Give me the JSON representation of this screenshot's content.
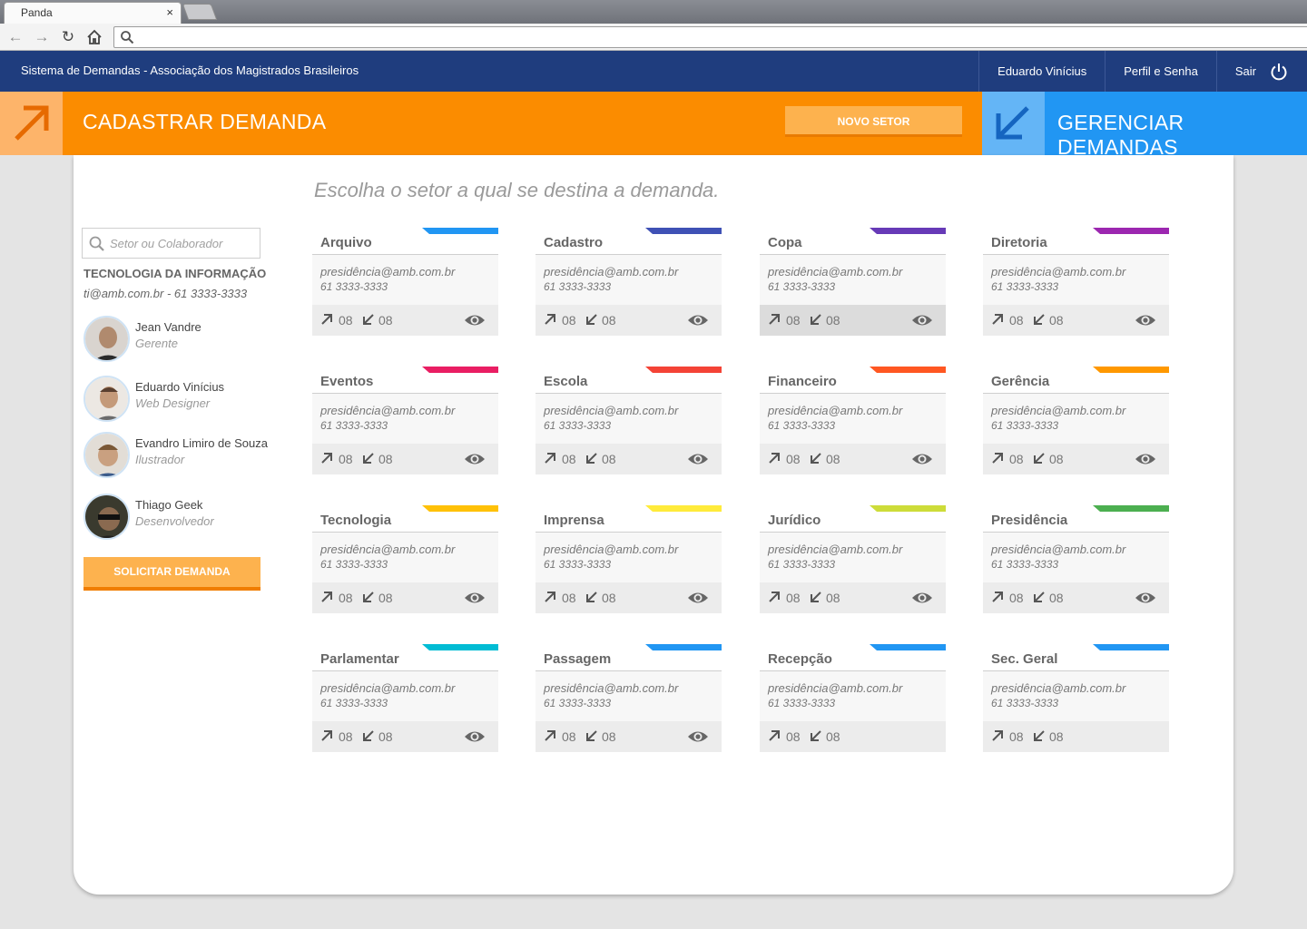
{
  "browser": {
    "tab_title": "Panda",
    "tab_close": "×",
    "url": ""
  },
  "header": {
    "app_title": "Sistema de Demandas - Associação dos Magistrados Brasileiros",
    "user_name": "Eduardo Vinícius",
    "profile_link": "Perfil e Senha",
    "logout_label": "Sair"
  },
  "actions": {
    "register_title": "CADASTRAR DEMANDA",
    "new_sector_button": "NOVO SETOR",
    "manage_title": "GERENCIAR DEMANDAS"
  },
  "main": {
    "subtitle": "Escolha o setor a qual se destina a demanda."
  },
  "sidebar": {
    "search_placeholder": "Setor ou Colaborador",
    "sector_name": "TECNOLOGIA DA INFORMAÇÃO",
    "sector_contact": "ti@amb.com.br - 61 3333-3333",
    "people": [
      {
        "name": "Jean Vandre",
        "role": "Gerente"
      },
      {
        "name": "Eduardo Vinícius",
        "role": "Web Designer"
      },
      {
        "name": "Evandro Limiro de Souza",
        "role": "Ilustrador"
      },
      {
        "name": "Thiago Geek",
        "role": "Desenvolvedor"
      }
    ],
    "request_button": "SOLICITAR DEMANDA"
  },
  "sectors": [
    {
      "name": "Arquivo",
      "email": "presidência@amb.com.br",
      "phone": "61 3333-3333",
      "sent": "08",
      "received": "08",
      "color": "#2196f3",
      "has_view": true
    },
    {
      "name": "Cadastro",
      "email": "presidência@amb.com.br",
      "phone": "61 3333-3333",
      "sent": "08",
      "received": "08",
      "color": "#3f51b5",
      "has_view": true
    },
    {
      "name": "Copa",
      "email": "presidência@amb.com.br",
      "phone": "61 3333-3333",
      "sent": "08",
      "received": "08",
      "color": "#673ab7",
      "has_view": true
    },
    {
      "name": "Diretoria",
      "email": "presidência@amb.com.br",
      "phone": "61 3333-3333",
      "sent": "08",
      "received": "08",
      "color": "#9c27b0",
      "has_view": true
    },
    {
      "name": "Eventos",
      "email": "presidência@amb.com.br",
      "phone": "61 3333-3333",
      "sent": "08",
      "received": "08",
      "color": "#e91e63",
      "has_view": true
    },
    {
      "name": "Escola",
      "email": "presidência@amb.com.br",
      "phone": "61 3333-3333",
      "sent": "08",
      "received": "08",
      "color": "#f44336",
      "has_view": true
    },
    {
      "name": "Financeiro",
      "email": "presidência@amb.com.br",
      "phone": "61 3333-3333",
      "sent": "08",
      "received": "08",
      "color": "#ff5722",
      "has_view": true
    },
    {
      "name": "Gerência",
      "email": "presidência@amb.com.br",
      "phone": "61 3333-3333",
      "sent": "08",
      "received": "08",
      "color": "#ff9800",
      "has_view": true
    },
    {
      "name": "Tecnologia",
      "email": "presidência@amb.com.br",
      "phone": "61 3333-3333",
      "sent": "08",
      "received": "08",
      "color": "#ffc107",
      "has_view": true
    },
    {
      "name": "Imprensa",
      "email": "presidência@amb.com.br",
      "phone": "61 3333-3333",
      "sent": "08",
      "received": "08",
      "color": "#ffeb3b",
      "has_view": true
    },
    {
      "name": "Jurídico",
      "email": "presidência@amb.com.br",
      "phone": "61 3333-3333",
      "sent": "08",
      "received": "08",
      "color": "#cddc39",
      "has_view": true
    },
    {
      "name": "Presidência",
      "email": "presidência@amb.com.br",
      "phone": "61 3333-3333",
      "sent": "08",
      "received": "08",
      "color": "#4caf50",
      "has_view": true
    },
    {
      "name": "Parlamentar",
      "email": "presidência@amb.com.br",
      "phone": "61 3333-3333",
      "sent": "08",
      "received": "08",
      "color": "#00bcd4",
      "has_view": true
    },
    {
      "name": "Passagem",
      "email": "presidência@amb.com.br",
      "phone": "61 3333-3333",
      "sent": "08",
      "received": "08",
      "color": "#2196f3",
      "has_view": true
    },
    {
      "name": "Recepção",
      "email": "presidência@amb.com.br",
      "phone": "61 3333-3333",
      "sent": "08",
      "received": "08",
      "color": "#2196f3",
      "has_view": false
    },
    {
      "name": "Sec. Geral",
      "email": "presidência@amb.com.br",
      "phone": "61 3333-3333",
      "sent": "08",
      "received": "08",
      "color": "#2196f3",
      "has_view": false
    }
  ],
  "colors": {
    "header_bg": "#1f3d7e",
    "orange": "#fb8c00",
    "blue": "#2196f3"
  }
}
